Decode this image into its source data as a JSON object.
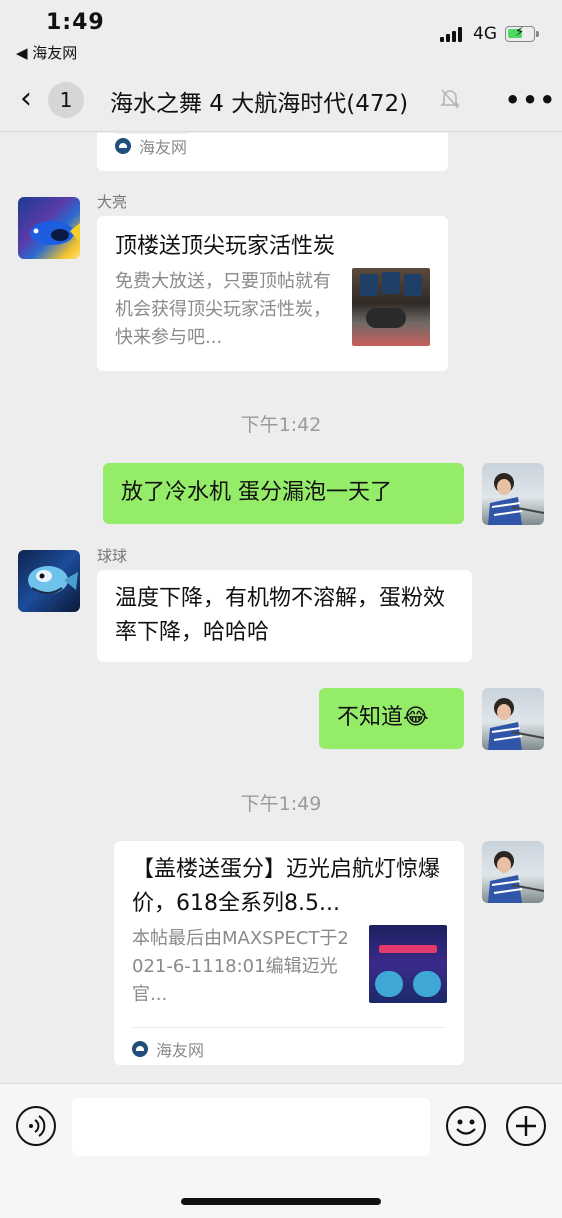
{
  "status_bar": {
    "time": "1:49",
    "back_app": "◀ 海友网",
    "network": "4G"
  },
  "nav": {
    "back_count": "1",
    "title": "海水之舞 4 大航海时代(472)"
  },
  "messages": {
    "top_card_source": "海友网",
    "m1": {
      "sender": "大亮",
      "card_title": "顶楼送顶尖玩家活性炭",
      "card_desc": "免费大放送，只要顶帖就有机会获得顶尖玩家活性炭，快来参与吧..."
    },
    "ts1": "下午1:42",
    "m2": {
      "text": "放了冷水机  蛋分漏泡一天了"
    },
    "m3": {
      "sender": "球球",
      "text": "温度下降，有机物不溶解，蛋粉效率下降，哈哈哈"
    },
    "m4": {
      "text": "不知道😂"
    },
    "ts2": "下午1:49",
    "m5": {
      "card_title": "【盖楼送蛋分】迈光启航灯惊爆价，618全系列8.5...",
      "card_desc": "本帖最后由MAXSPECT于2021-6-1118:01编辑迈光官...",
      "source": "海友网"
    }
  },
  "colors": {
    "sent_bubble": "#95ec69",
    "received_bubble": "#ffffff",
    "background": "#ededed"
  }
}
